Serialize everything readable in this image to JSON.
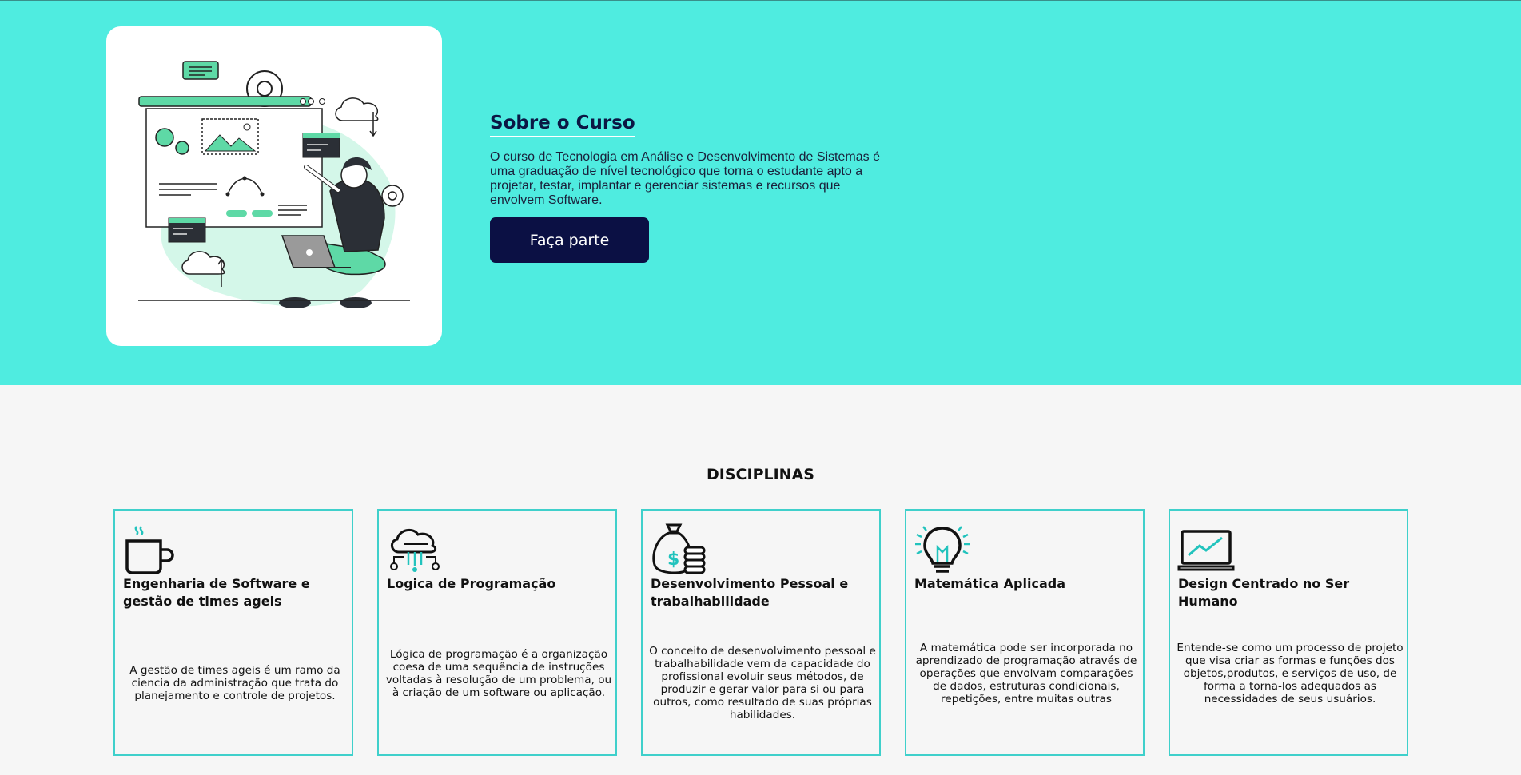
{
  "hero": {
    "title": "Sobre o Curso",
    "description": "O curso de Tecnologia em Análise e Desenvolvimento de Sistemas é uma graduação de nível tecnológico que torna o estudante apto a projetar, testar, implantar e gerenciar sistemas e recursos que envolvem Software.",
    "cta_label": "Faça parte",
    "illustration": "developer-at-whiteboard-illustration"
  },
  "disciplines": {
    "title": "DISCIPLINAS",
    "items": [
      {
        "icon": "coffee-cup-icon",
        "title": "Engenharia de Software e gestão de times ageis",
        "description": "A gestão de times ageis é um ramo da ciencia da administração que trata do planejamento e controle de projetos."
      },
      {
        "icon": "cloud-network-icon",
        "title": "Logica de Programação",
        "description": "Lógica de programação é a organização coesa de uma sequência de instruções voltadas à resolução de um problema, ou à criação de um software ou aplicação."
      },
      {
        "icon": "money-bag-coins-icon",
        "title": "Desenvolvimento Pessoal e trabalhabilidade",
        "description": "O conceito de desenvolvimento pessoal e trabalhabilidade vem da capacidade do profissional evoluir seus métodos, de produzir e gerar valor para si ou para outros, como resultado de suas próprias habilidades."
      },
      {
        "icon": "light-bulb-icon",
        "title": "Matemática Aplicada",
        "description": "A matemática pode ser incorporada no aprendizado de programação através de operações que envolvam comparações de dados, estruturas condicionais, repetições, entre muitas outras"
      },
      {
        "icon": "laptop-chart-icon",
        "title": "Design Centrado no Ser Humano",
        "description": "Entende-se como um processo de projeto que visa criar as formas e funções dos objetos,produtos, e serviços de uso, de forma a torna-los adequados as necessidades de seus usuários."
      }
    ]
  },
  "colors": {
    "hero_bg": "#4fece0",
    "button_bg": "#0b1044",
    "card_border": "#3fd0cb",
    "accent": "#34d39a"
  }
}
